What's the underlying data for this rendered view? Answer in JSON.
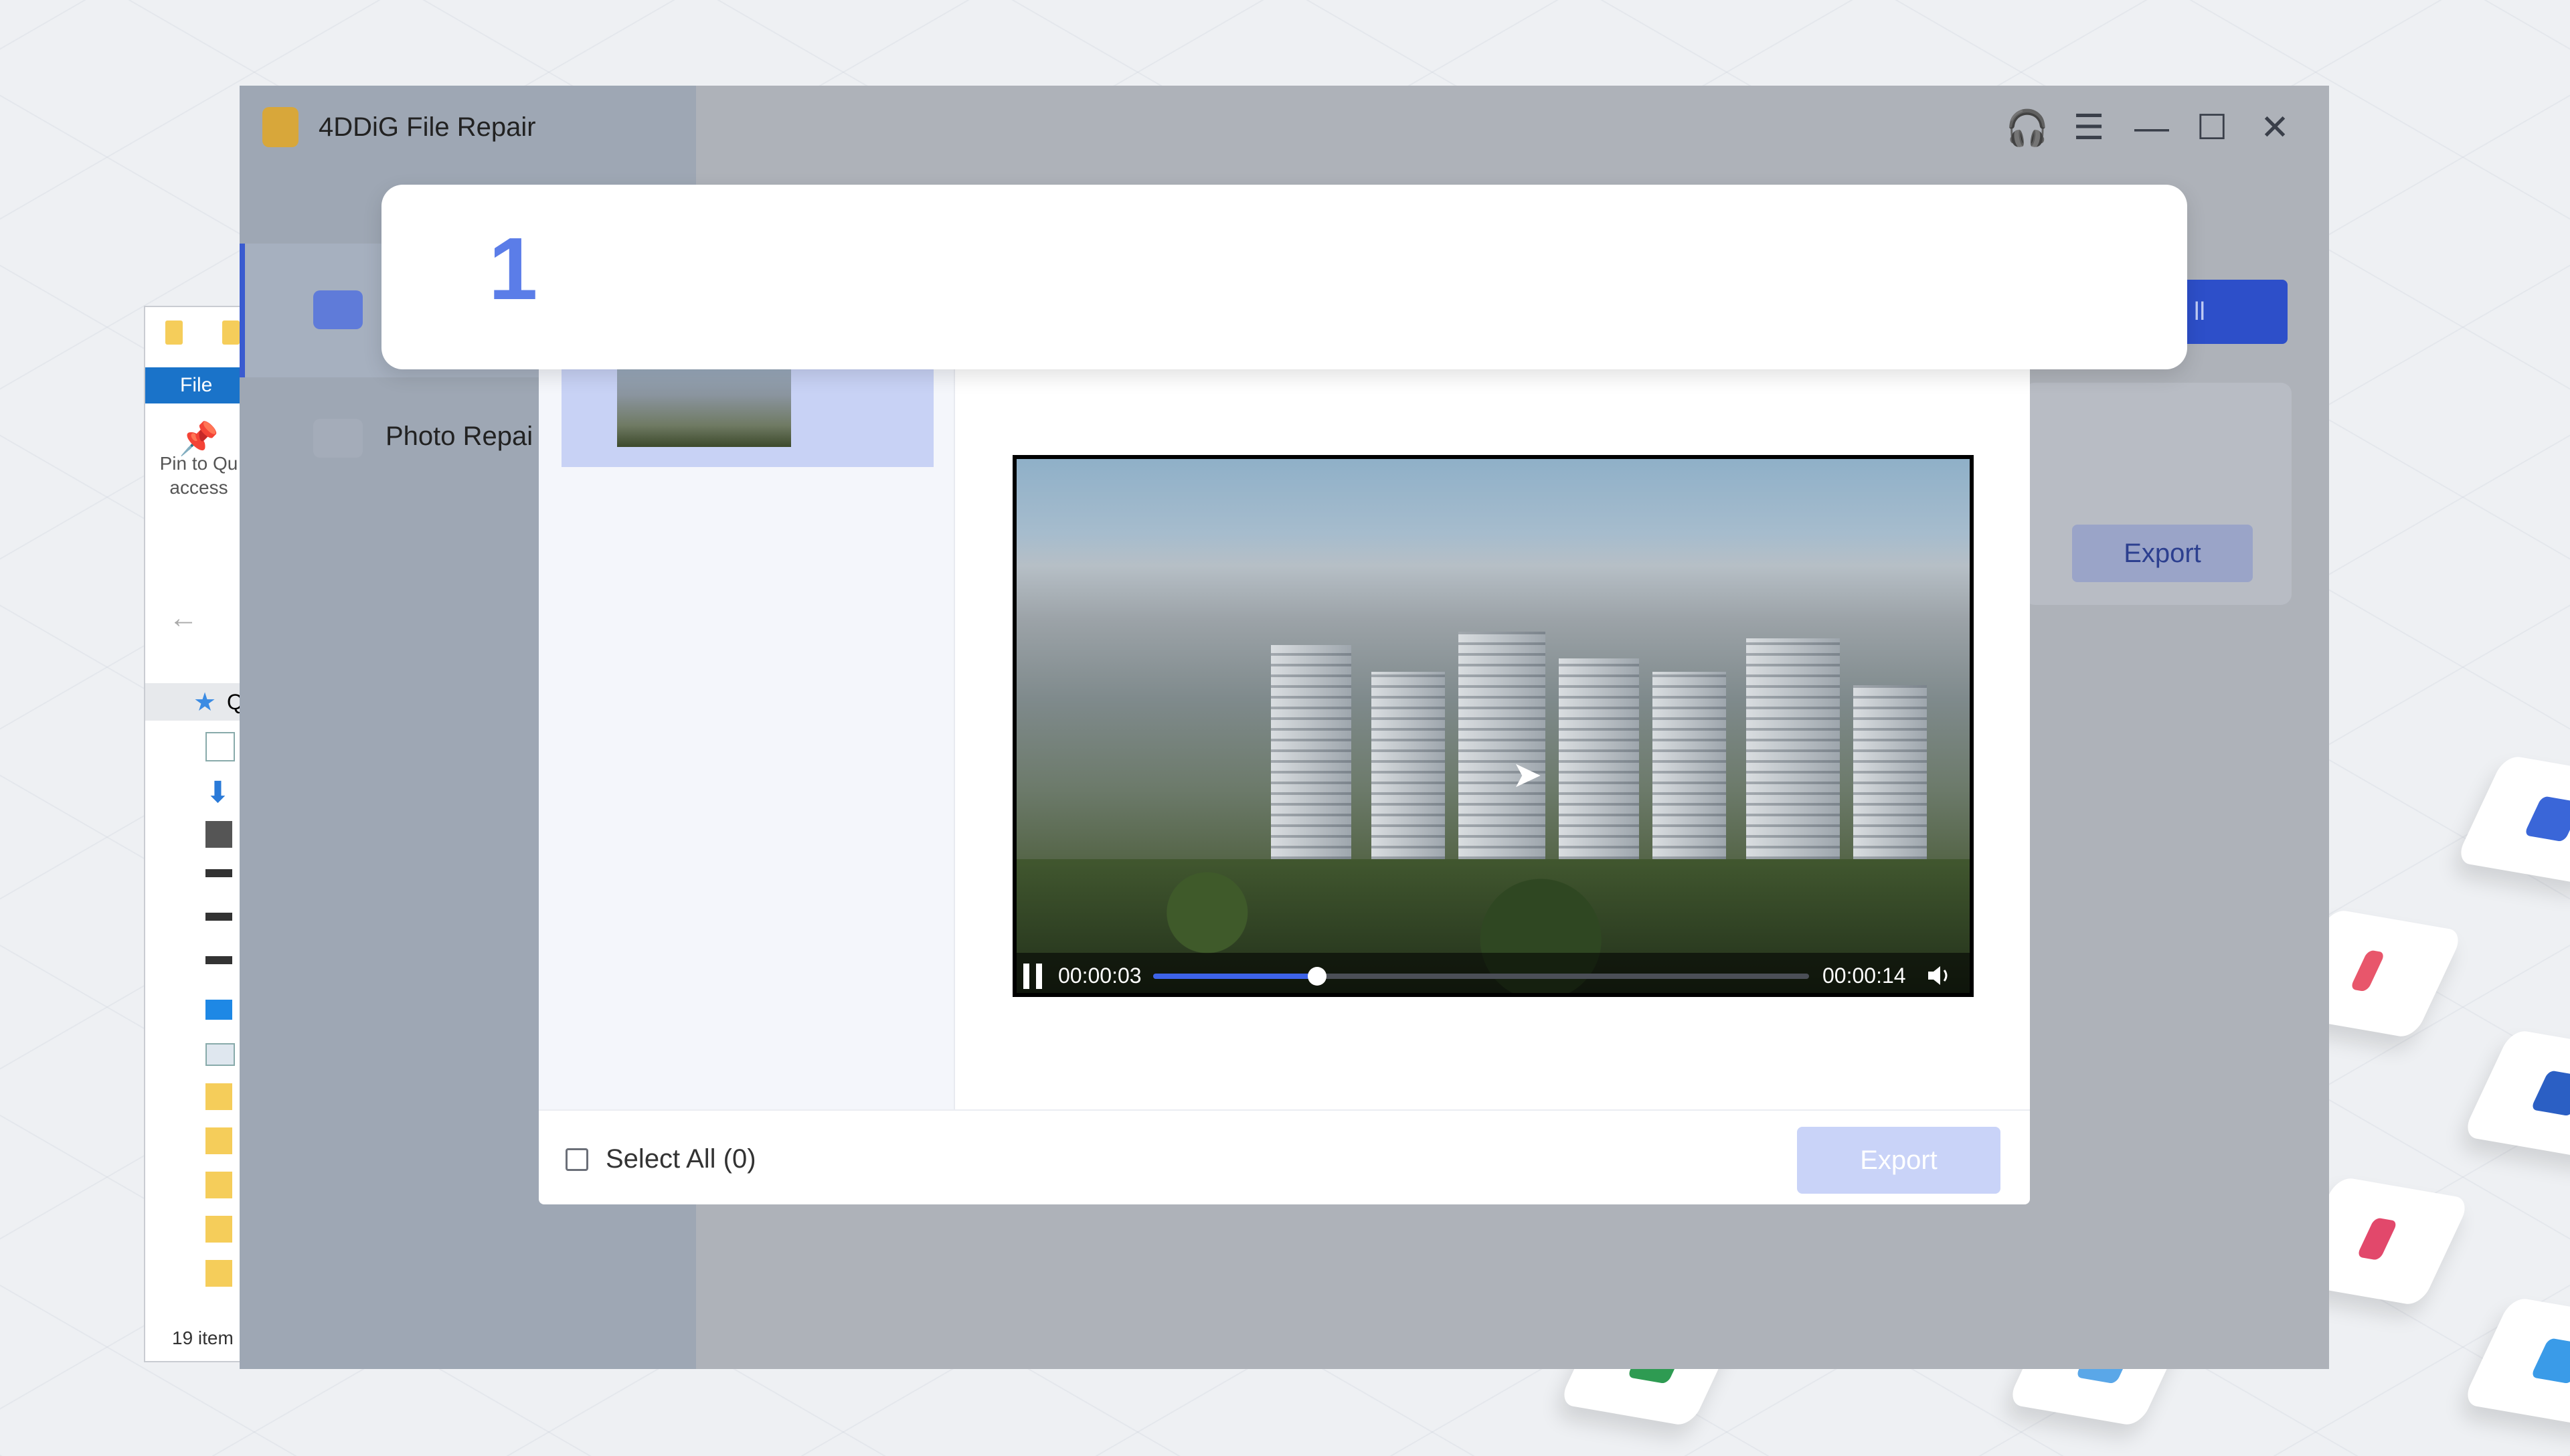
{
  "app": {
    "title": "4DDiG File Repair",
    "sidebar": [
      {
        "label": "",
        "icon": "video-repair-icon"
      },
      {
        "label": "Photo Repai",
        "icon": "photo-repair-icon"
      }
    ],
    "repair_all_label": "ll",
    "bg_export_label": "Export"
  },
  "explorer": {
    "file_tab": "File",
    "pin_label": "Pin to Qu access",
    "quick_label": "Q",
    "status": "19 item"
  },
  "dialog": {
    "select_all_label": "Select All (0)",
    "export_label": "Export",
    "player": {
      "current_time": "00:00:03",
      "total_time": "00:00:14",
      "progress": 0.25
    }
  },
  "banner": {
    "step_number": "1"
  },
  "colors": {
    "accent": "#3d63e8",
    "banner_number": "#5b7de8"
  }
}
